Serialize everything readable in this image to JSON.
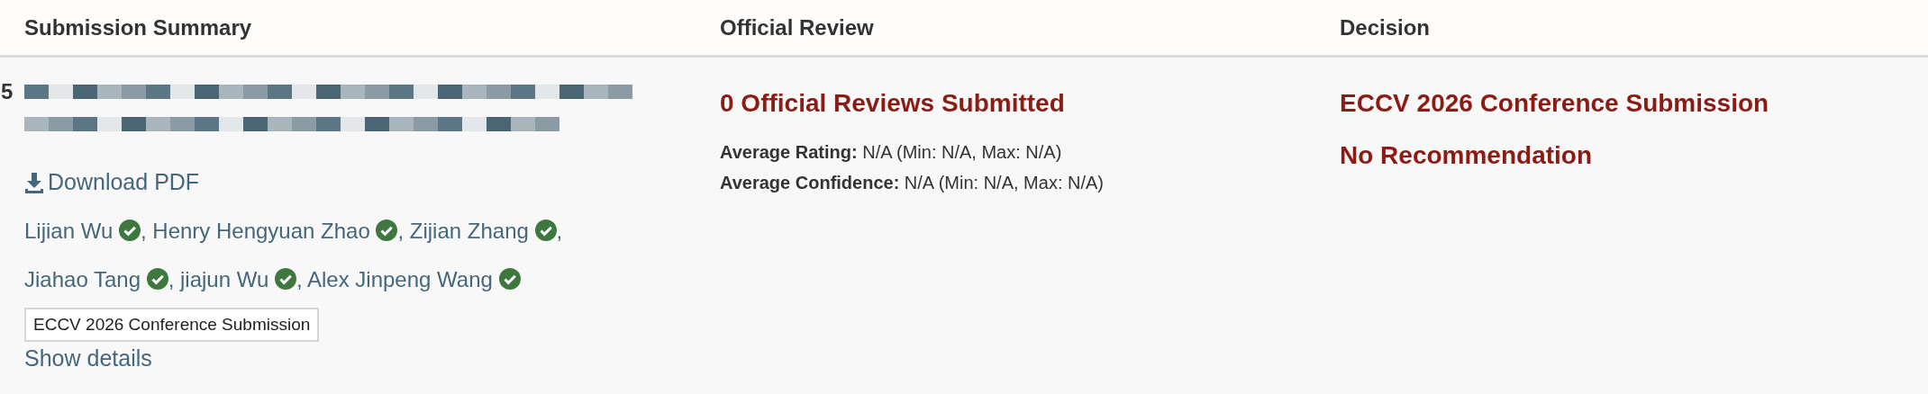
{
  "columns": [
    "Submission Summary",
    "Official Review",
    "Decision"
  ],
  "submission": {
    "number": "5",
    "download_link": "Download PDF",
    "authors": [
      {
        "name": "Lijian Wu",
        "verified": true,
        "separator": ","
      },
      {
        "name": "Henry Hengyuan Zhao",
        "verified": true,
        "separator": ","
      },
      {
        "name": "Zijian Zhang",
        "verified": true,
        "separator": ","
      },
      {
        "name": "Jiahao Tang",
        "verified": true,
        "separator": ","
      },
      {
        "name": "jiajun Wu",
        "verified": true,
        "separator": ","
      },
      {
        "name": "Alex Jinpeng Wang",
        "verified": true
      }
    ],
    "venue_badge": "ECCV 2026 Conference Submission",
    "details_link": "Show details"
  },
  "review": {
    "heading": "0 Official Reviews Submitted",
    "stats": [
      {
        "label": "Average Rating:",
        "value": "N/A (Min: N/A, Max: N/A)"
      },
      {
        "label": "Average Confidence:",
        "value": "N/A (Min: N/A, Max: N/A)"
      }
    ]
  },
  "decision": {
    "venue": "ECCV 2026 Conference Submission",
    "recommendation": "No Recommendation"
  }
}
